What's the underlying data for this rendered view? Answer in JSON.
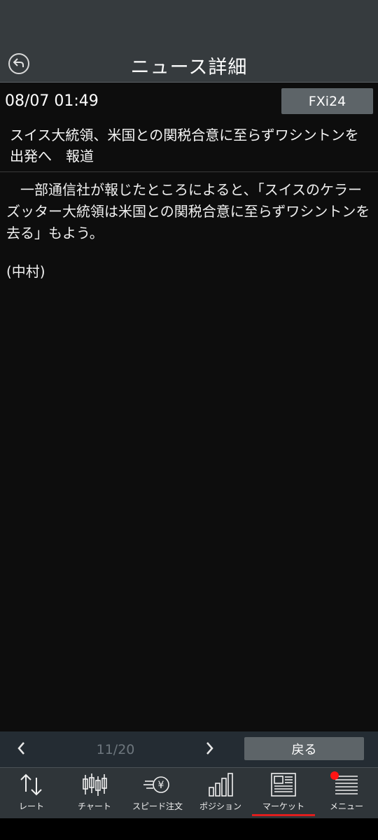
{
  "header": {
    "title": "ニュース詳細",
    "back_icon": "back-arrow-icon"
  },
  "article": {
    "date": "08/07 01:49",
    "source": "FXi24",
    "headline": "スイス大統領、米国との関税合意に至らずワシントンを出発へ　報道",
    "body": "　一部通信社が報じたところによると、「スイスのケラーズッター大統領は米国との関税合意に至らずワシントンを去る」もよう。",
    "author": "(中村)"
  },
  "pager": {
    "page_count": "11/20",
    "return_label": "戻る"
  },
  "tabs": [
    {
      "label": "レート",
      "icon": "rate-arrows-icon"
    },
    {
      "label": "チャート",
      "icon": "candlestick-icon"
    },
    {
      "label": "スピード注文",
      "icon": "speed-order-icon"
    },
    {
      "label": "ポジション",
      "icon": "position-bars-icon"
    },
    {
      "label": "マーケット",
      "icon": "newspaper-icon",
      "active": true
    },
    {
      "label": "メニュー",
      "icon": "menu-lines-icon",
      "has_badge": true
    }
  ],
  "colors": {
    "accent": "#e01d1d",
    "badge": "#ff1414",
    "button": "#5d6468"
  }
}
